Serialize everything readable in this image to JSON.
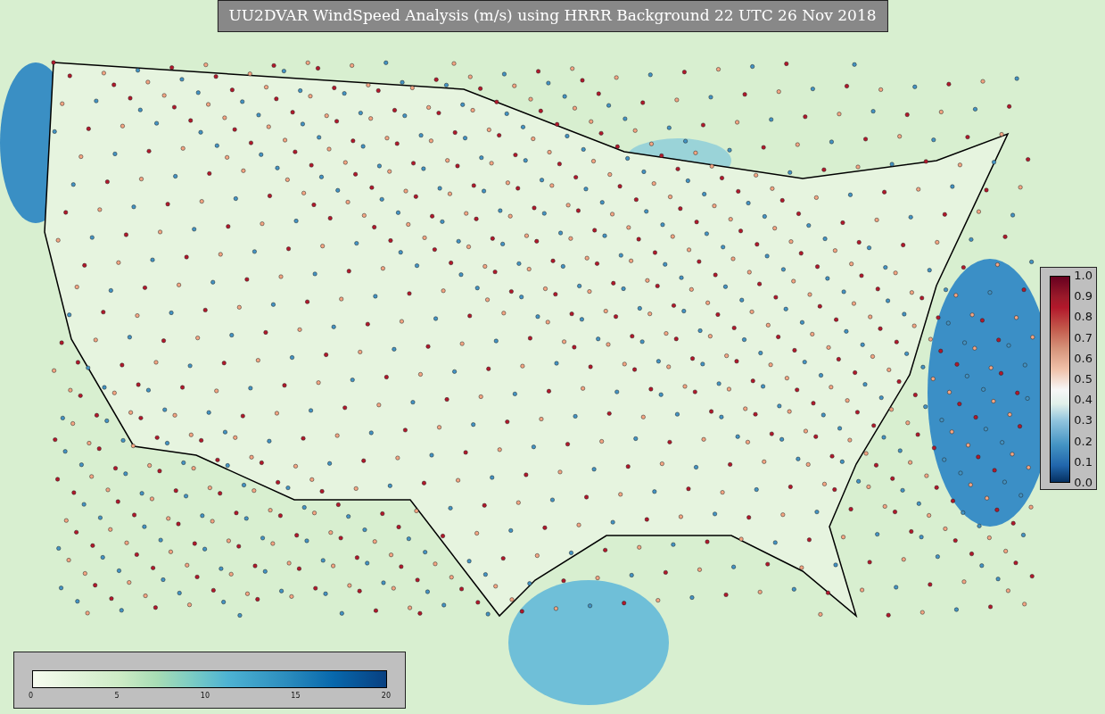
{
  "title": "UU2DVAR WindSpeed Analysis (m/s) using HRRR Background 22 UTC 26 Nov 2018",
  "ratio_legend": {
    "ticks": [
      "1.0",
      "0.9",
      "0.8",
      "0.7",
      "0.6",
      "0.5",
      "0.4",
      "0.3",
      "0.2",
      "0.1",
      "0.0"
    ]
  },
  "speed_legend": {
    "ticks": [
      "0",
      "5",
      "10",
      "15",
      "20"
    ]
  }
}
